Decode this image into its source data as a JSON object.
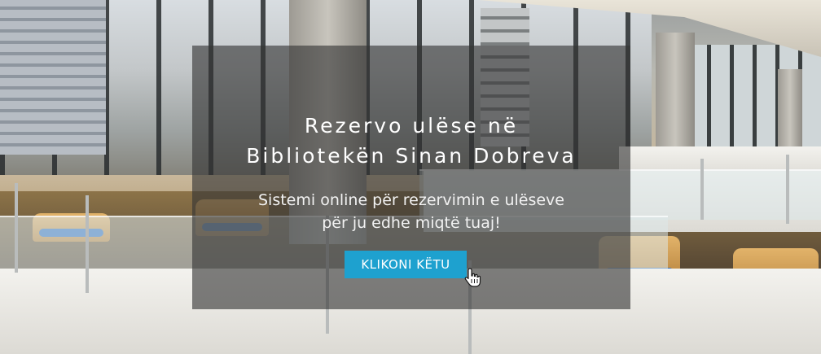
{
  "hero": {
    "title_line1": "Rezervo ulëse në",
    "title_line2": "Bibliotekën Sinan Dobreva",
    "subtitle_line1": "Sistemi online për rezervimin e ulëseve",
    "subtitle_line2": "për ju edhe miqtë tuaj!",
    "cta_label": "KLIKONI KËTU",
    "cta_color": "#1ea1cf",
    "cursor_icon": "hand-pointer-icon"
  }
}
